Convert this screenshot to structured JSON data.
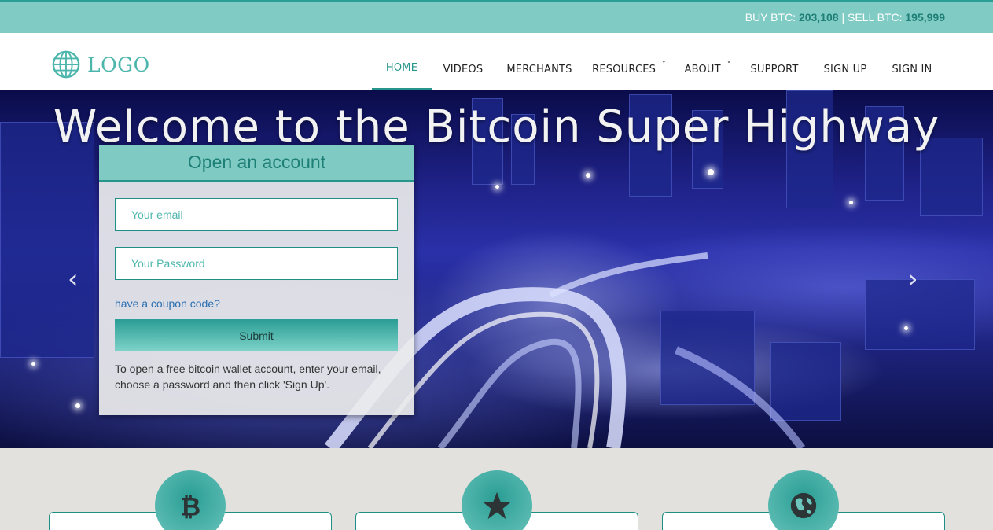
{
  "ticker": {
    "buy_label": "BUY BTC:",
    "buy_value": "203,108",
    "separator": "|",
    "sell_label": "SELL BTC:",
    "sell_value": "195,999"
  },
  "logo": {
    "text": "LOGO",
    "icon": "globe-icon"
  },
  "nav": {
    "home": "HOME",
    "videos": "VIDEOS",
    "merchants": "MERCHANTS",
    "resources": "RESOURCES",
    "about": "ABOUT",
    "support": "SUPPORT",
    "signup": "SIGN UP",
    "signin": "SIGN IN",
    "caret": "˅",
    "active": "HOME"
  },
  "hero": {
    "title": "Welcome to the Bitcoin Super Highway",
    "prev_arrow": "‹",
    "next_arrow": "›"
  },
  "signup": {
    "heading": "Open an account",
    "email_placeholder": "Your email",
    "email_value": "",
    "password_placeholder": "Your Password",
    "password_value": "",
    "coupon_link": "have a coupon code?",
    "submit_label": "Submit",
    "help_text": "To open a free bitcoin wallet account, enter your email, choose a password and then click 'Sign Up'."
  },
  "features": {
    "icons": [
      "bitcoin-icon",
      "star-icon",
      "globe-icon"
    ]
  },
  "colors": {
    "accent": "#26968c",
    "accent_light": "#80cbc4",
    "link": "#2a6fb0"
  }
}
